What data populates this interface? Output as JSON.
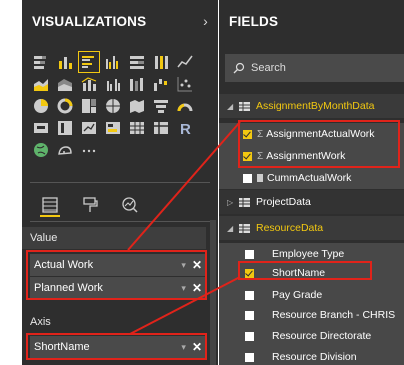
{
  "visualizations": {
    "title": "VISUALIZATIONS",
    "expand_icon": "chevron-right-icon",
    "icon_names": [
      [
        "stacked-bar-icon",
        "stacked-column-icon",
        "clustered-bar-icon",
        "clustered-column-icon",
        "100-stacked-bar-icon",
        "100-stacked-column-icon",
        "line-chart-icon"
      ],
      [
        "area-chart-icon",
        "stacked-area-icon",
        "line-stacked-column-icon",
        "line-clustered-column-icon",
        "ribbon-chart-icon",
        "waterfall-icon",
        "scatter-icon"
      ],
      [
        "pie-chart-icon",
        "donut-chart-icon",
        "treemap-icon",
        "map-icon",
        "filled-map-icon",
        "funnel-icon",
        "gauge-icon"
      ],
      [
        "card-icon",
        "multi-row-card-icon",
        "kpi-icon",
        "slicer-icon",
        "table-icon",
        "matrix-icon",
        "r-visual-icon"
      ],
      [
        "globe-icon",
        "arcgis-icon",
        "more-ellipsis"
      ]
    ],
    "selected_icon": "clustered-bar-icon",
    "well_tabs": [
      "fields-tab-icon",
      "format-paint-icon",
      "analytics-icon"
    ],
    "value_label": "Value",
    "value_fields": [
      "Actual Work",
      "Planned Work"
    ],
    "axis_label": "Axis",
    "axis_fields": [
      "ShortName"
    ],
    "dropdown_glyph": "▾",
    "remove_glyph": "✕"
  },
  "fields": {
    "title": "FIELDS",
    "search_placeholder": "Search",
    "tables": [
      {
        "name": "AssignmentByMonthData",
        "expanded": true,
        "fields": [
          {
            "name": "AssignmentActualWork",
            "checked": true,
            "type": "sum"
          },
          {
            "name": "AssignmentWork",
            "checked": true,
            "type": "sum"
          },
          {
            "name": "CummActualWork",
            "checked": false,
            "type": "calc"
          }
        ]
      },
      {
        "name": "ProjectData",
        "expanded": false,
        "fields": []
      },
      {
        "name": "ResourceData",
        "expanded": true,
        "fields": [
          {
            "name": "Employee Type",
            "checked": false,
            "type": "text"
          },
          {
            "name": "ShortName",
            "checked": true,
            "type": "text"
          },
          {
            "name": "Pay Grade",
            "checked": false,
            "type": "text"
          },
          {
            "name": "Resource Branch - CHRIS",
            "checked": false,
            "type": "text"
          },
          {
            "name": "Resource Directorate",
            "checked": false,
            "type": "text"
          },
          {
            "name": "Resource Division",
            "checked": false,
            "type": "text"
          }
        ]
      }
    ],
    "sigma_glyph": "Σ",
    "expanded_arrow": "◢",
    "collapsed_arrow": "▷"
  },
  "colors": {
    "pane_bg": "#2e2e2e",
    "accent_yellow": "#f2c811",
    "highlight_red": "#e0231a",
    "left_strip": "#ffffff"
  }
}
